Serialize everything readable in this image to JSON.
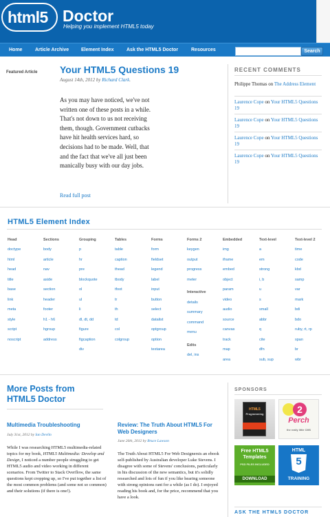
{
  "header": {
    "logo_left": "html5",
    "logo_right": "Doctor",
    "tagline": "Helping you implement HTML5 today"
  },
  "nav": {
    "items": [
      "Home",
      "Article Archive",
      "Element Index",
      "Ask the HTML5 Doctor",
      "Resources"
    ],
    "search_placeholder": "",
    "search_button": "Search"
  },
  "featured": {
    "label": "Featured Article",
    "title": "Your HTML5 Questions 19",
    "meta_prefix": "August 14th, 2012 by ",
    "author": "Richard Clark",
    "meta_suffix": ".",
    "excerpt": "As you may have noticed, we've not written one of these posts in a while. That's not down to us not receiving them, though. Government cutbacks have hit health services hard, so decisions had to be made. Well, that and the fact that we've all just been manically busy with our day jobs.",
    "read_more": "Read full post"
  },
  "recent_comments": {
    "heading": "RECENT COMMENTS",
    "items": [
      {
        "author": "Philippe Thomas",
        "on": " on ",
        "post": "The Address Element"
      },
      {
        "author": "Laurence Cope",
        "on": " on ",
        "post": "Your HTML5 Questions 19"
      },
      {
        "author": "Laurence Cope",
        "on": " on ",
        "post": "Your HTML5 Questions 19"
      },
      {
        "author": "Laurence Cope",
        "on": " on ",
        "post": "Your HTML5 Questions 19"
      },
      {
        "author": "Laurence Cope",
        "on": " on ",
        "post": "Your HTML5 Questions 19"
      }
    ]
  },
  "element_index": {
    "heading": "HTML5 Element Index",
    "columns": [
      {
        "title": "Head",
        "items": [
          "doctype",
          "html",
          "head",
          "title",
          "base",
          "link",
          "meta",
          "style",
          "script",
          "noscript"
        ]
      },
      {
        "title": "Sections",
        "items": [
          "body",
          "article",
          "nav",
          "aside",
          "section",
          "header",
          "footer",
          "h1 - h6",
          "hgroup",
          "address"
        ]
      },
      {
        "title": "Grouping",
        "items": [
          "p",
          "hr",
          "pre",
          "blockquote",
          "ol",
          "ul",
          "li",
          "dl, dt, dd",
          "figure",
          "figcaption",
          "div"
        ]
      },
      {
        "title": "Tables",
        "items": [
          "table",
          "caption",
          "thead",
          "tbody",
          "tfoot",
          "tr",
          "th",
          "td",
          "col",
          "colgroup"
        ]
      },
      {
        "title": "Forms",
        "items": [
          "form",
          "fieldset",
          "legend",
          "label",
          "input",
          "button",
          "select",
          "datalist",
          "optgroup",
          "option",
          "textarea"
        ]
      },
      {
        "title": "Forms 2",
        "items": [
          "keygen",
          "output",
          "progress",
          "meter"
        ],
        "sub1": "Interactive",
        "items2": [
          "details",
          "summary",
          "command",
          "menu"
        ],
        "sub2": "Edits",
        "items3": [
          "del, ins"
        ]
      },
      {
        "title": "Embedded",
        "items": [
          "img",
          "iframe",
          "embed",
          "object",
          "param",
          "video",
          "audio",
          "source",
          "canvas",
          "track",
          "map",
          "area"
        ]
      },
      {
        "title": "Text-level",
        "items": [
          "a",
          "em",
          "strong",
          "i, b",
          "u",
          "s",
          "small",
          "abbr",
          "q",
          "cite",
          "dfn",
          "sub, sup"
        ]
      },
      {
        "title": "Text-level 2",
        "items": [
          "time",
          "code",
          "kbd",
          "samp",
          "var",
          "mark",
          "bdi",
          "bdo",
          "ruby, rt, rp",
          "span",
          "br",
          "wbr"
        ]
      }
    ]
  },
  "more_posts": {
    "heading": "More Posts from HTML5 Doctor",
    "posts": [
      {
        "title": "Multimedia Troubleshooting",
        "meta_prefix": "July 31st, 2012 by ",
        "author": "Ian Devlin",
        "body_a": "While I was researching HTML5 multimedia-related topics for my book, ",
        "body_em": "HTML5 Multimedia: Develop and Design",
        "body_b": ", I noticed a number people struggling to get HTML5 audio and video working in different scenarios. From Twitter to Stack Overflow, the same questions kept cropping up, so I've put together a list of the most common problems (and some not so common) and their solutions (if there is one!)."
      },
      {
        "title": "Review: The Truth About HTML5 For Web Designers",
        "meta_prefix": "June 26th, 2012 by ",
        "author": "Bruce Lawson",
        "body_a": "The Truth About HTML5 For Web Designersis an ebook self-published by Australian developer Luke Stevens. I disagree with some of Stevens' conclusions, particularly in his discussion of the new semantics, but it's solidly researched and lots of fun if you like hearing someone with strong opinions rant for a while (as I do). I enjoyed reading his book and, for the price, recommend that you have a look.",
        "body_em": "",
        "body_b": ""
      }
    ]
  },
  "sponsors": {
    "heading": "SPONSORS",
    "ads": [
      {
        "line1": "HTML5",
        "line2": "Programming"
      },
      {
        "line1": "Perch",
        "line2": "the really little CMS",
        "badge": "2"
      },
      {
        "line1": "Free HTML5",
        "line2": "Templates",
        "line3": "PSD FILES INCLUDED",
        "line4": "DOWNLOAD"
      },
      {
        "line1": "HTML",
        "line2": "5",
        "line3": "TRAINING"
      }
    ]
  },
  "ask": {
    "heading": "ASK THE HTML5 DOCTOR"
  },
  "colors": {
    "brand_blue": "#0b63ad",
    "nav_blue": "#1a79c6",
    "link_blue": "#1a79c6"
  }
}
